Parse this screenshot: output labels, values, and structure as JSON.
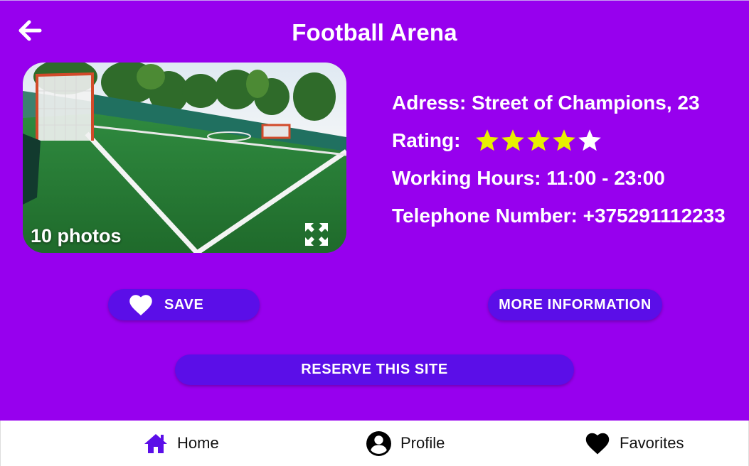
{
  "header": {
    "title": "Football Arena",
    "back_icon": "arrow-left-icon"
  },
  "photo": {
    "count_label": "10 photos",
    "expand_icon": "expand-icon"
  },
  "details": {
    "address": "Adress: Street of Champions, 23",
    "rating_label": "Rating:",
    "rating_value": 4,
    "rating_max": 5,
    "working_hours": "Working Hours: 11:00 - 23:00",
    "telephone": "Telephone Number: +375291112233"
  },
  "actions": {
    "save_label": "SAVE",
    "save_icon": "heart-icon",
    "more_info_label": "MORE INFORMATION",
    "reserve_label": "RESERVE THIS SITE"
  },
  "bottom_nav": {
    "items": [
      {
        "label": "Home",
        "icon": "home-icon"
      },
      {
        "label": "Profile",
        "icon": "account-circle-icon"
      },
      {
        "label": "Favorites",
        "icon": "heart-icon"
      }
    ]
  },
  "colors": {
    "background": "#9700ee",
    "button": "#5b0ee8",
    "star_filled": "#e8f000",
    "star_empty": "#ffffff",
    "nav_active": "#5b0ee8"
  }
}
